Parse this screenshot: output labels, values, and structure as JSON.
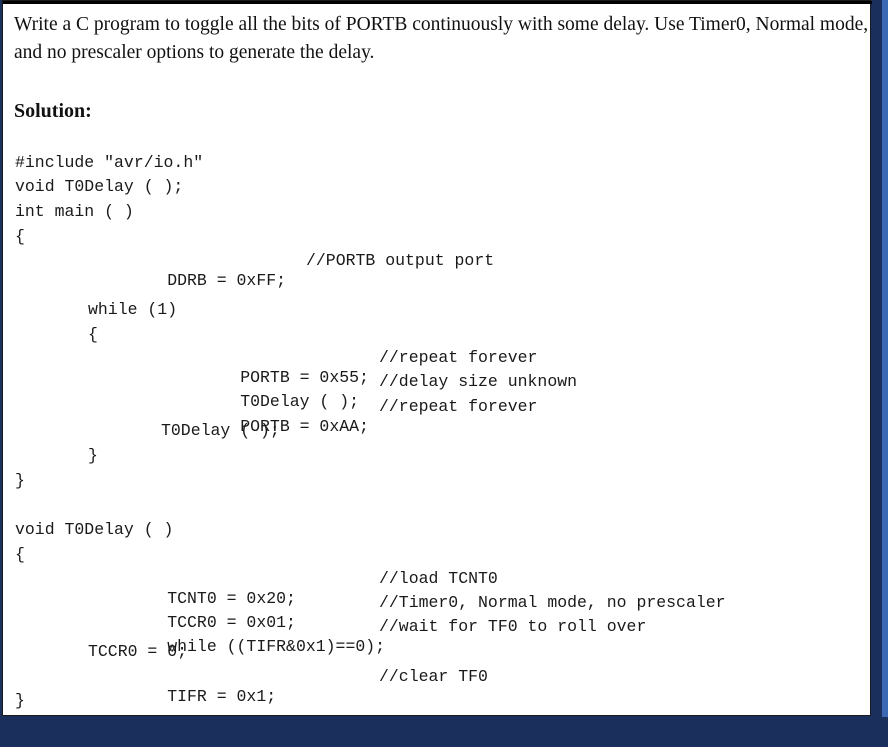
{
  "question": "Write a C program to toggle all the bits of PORTB continuously with some delay. Use Timer0, Normal mode, and no prescaler options to generate the delay.",
  "solution_label": "Solution:",
  "code": {
    "l1": "#include \"avr/io.h\"",
    "l2": "void T0Delay ( );",
    "l3": "int main ( )",
    "l4": "{",
    "l5_code": "DDRB = 0xFF;",
    "l5_comment": "//PORTB output port",
    "l6": "while (1)",
    "l7": "{",
    "l8_code": "PORTB = 0x55;",
    "l8_comment": "//repeat forever",
    "l9_code": "T0Delay ( );",
    "l9_comment": "//delay size unknown",
    "l10_code": "PORTB = 0xAA;",
    "l10_comment": "//repeat forever",
    "l11": "T0Delay ( );",
    "l12": "}",
    "l13": "}",
    "l14": "void T0Delay ( )",
    "l15": "{",
    "l16_code": "TCNT0 = 0x20;",
    "l16_comment": "//load TCNT0",
    "l17_code": "TCCR0 = 0x01;",
    "l17_comment": "//Timer0, Normal mode, no prescaler",
    "l18_code": "while ((TIFR&0x1)==0);",
    "l18_comment": "//wait for TF0 to roll over",
    "l19": "TCCR0 = 0;",
    "l20_code": "TIFR = 0x1;",
    "l20_comment": "//clear TF0",
    "l21": "}"
  },
  "colors": {
    "page_background": "#ffffff",
    "outer_background": "#1b2f5c",
    "accent_stripe": "#3b67b5",
    "text": "#111111"
  }
}
